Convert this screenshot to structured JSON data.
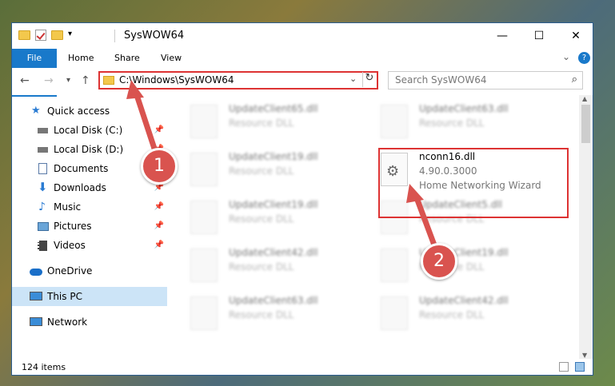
{
  "window": {
    "title": "SysWOW64",
    "controls": {
      "minimize": "—",
      "maximize": "☐",
      "close": "✕"
    }
  },
  "ribbon": {
    "tabs": [
      "File",
      "Home",
      "Share",
      "View"
    ],
    "expand": "⌄",
    "help": "?"
  },
  "address": {
    "path": "C:\\Windows\\SysWOW64",
    "dropdown": "⌄",
    "refresh": "↻"
  },
  "search": {
    "placeholder": "Search SysWOW64"
  },
  "sidebar": {
    "items": [
      {
        "label": "Quick access",
        "icon": "star-icon",
        "pinned": false
      },
      {
        "label": "Local Disk (C:)",
        "icon": "drive-icon",
        "pinned": true
      },
      {
        "label": "Local Disk (D:)",
        "icon": "drive-icon",
        "pinned": true
      },
      {
        "label": "Documents",
        "icon": "document-icon",
        "pinned": true
      },
      {
        "label": "Downloads",
        "icon": "download-icon",
        "pinned": true
      },
      {
        "label": "Music",
        "icon": "music-icon",
        "pinned": true
      },
      {
        "label": "Pictures",
        "icon": "pictures-icon",
        "pinned": true
      },
      {
        "label": "Videos",
        "icon": "videos-icon",
        "pinned": true
      },
      {
        "label": "OneDrive",
        "icon": "onedrive-icon",
        "pinned": false
      },
      {
        "label": "This PC",
        "icon": "computer-icon",
        "pinned": false
      },
      {
        "label": "Network",
        "icon": "network-icon",
        "pinned": false
      }
    ]
  },
  "files": {
    "left": [
      {
        "name": "UpdateClient65.dll",
        "desc": "Resource DLL"
      },
      {
        "name": "UpdateClient19.dll",
        "desc": "Resource DLL"
      },
      {
        "name": "UpdateClient19.dll",
        "desc": "Resource DLL"
      },
      {
        "name": "UpdateClient42.dll",
        "desc": "Resource DLL"
      },
      {
        "name": "UpdateClient63.dll",
        "desc": "Resource DLL"
      }
    ],
    "right": [
      {
        "name": "UpdateClient63.dll",
        "desc": "Resource DLL"
      },
      {
        "name": "nconn16.dll",
        "desc": "4.90.0.3000",
        "desc2": "Home Networking Wizard"
      },
      {
        "name": "UpdateClient5.dll",
        "desc": "Resource DLL"
      },
      {
        "name": "UpdateClient19.dll",
        "desc": "Resource DLL"
      },
      {
        "name": "UpdateClient42.dll",
        "desc": "Resource DLL"
      }
    ]
  },
  "status": {
    "count": "124 items"
  },
  "annotations": {
    "badge1": "1",
    "badge2": "2",
    "color": "#d9534f"
  }
}
